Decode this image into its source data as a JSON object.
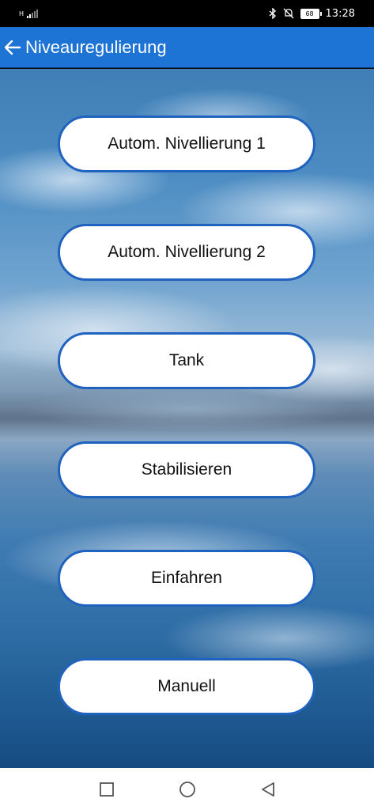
{
  "status_bar": {
    "time": "13:28",
    "battery": "68",
    "network": "H"
  },
  "app_bar": {
    "title": "Niveauregulierung"
  },
  "buttons": [
    {
      "label": "Autom. Nivellierung 1"
    },
    {
      "label": "Autom. Nivellierung 2"
    },
    {
      "label": "Tank"
    },
    {
      "label": "Stabilisieren"
    },
    {
      "label": "Einfahren"
    },
    {
      "label": "Manuell"
    }
  ],
  "colors": {
    "app_bar": "#1e74d4",
    "button_border": "#1f62c0",
    "button_fill": "#ffffff"
  },
  "icons": {
    "back": "arrow-left-icon",
    "nav_recents": "square-icon",
    "nav_home": "circle-icon",
    "nav_back": "triangle-back-icon"
  }
}
